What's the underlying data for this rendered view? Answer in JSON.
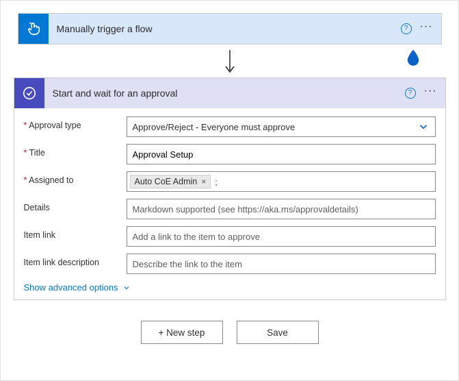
{
  "trigger": {
    "title": "Manually trigger a flow",
    "icon": "touch-icon"
  },
  "approval": {
    "title": "Start and wait for an approval",
    "icon": "approval-check-icon",
    "fields": {
      "approval_type": {
        "label": "Approval type",
        "value": "Approve/Reject - Everyone must approve"
      },
      "title": {
        "label": "Title",
        "value": "Approval Setup"
      },
      "assigned_to": {
        "label": "Assigned to",
        "tokens": [
          "Auto CoE Admin"
        ],
        "trailing": ";"
      },
      "details": {
        "label": "Details",
        "placeholder": "Markdown supported (see https://aka.ms/approvaldetails)"
      },
      "item_link": {
        "label": "Item link",
        "placeholder": "Add a link to the item to approve"
      },
      "item_link_description": {
        "label": "Item link description",
        "placeholder": "Describe the link to the item"
      }
    },
    "advanced_link": "Show advanced options"
  },
  "footer": {
    "new_step": "+ New step",
    "save": "Save"
  }
}
